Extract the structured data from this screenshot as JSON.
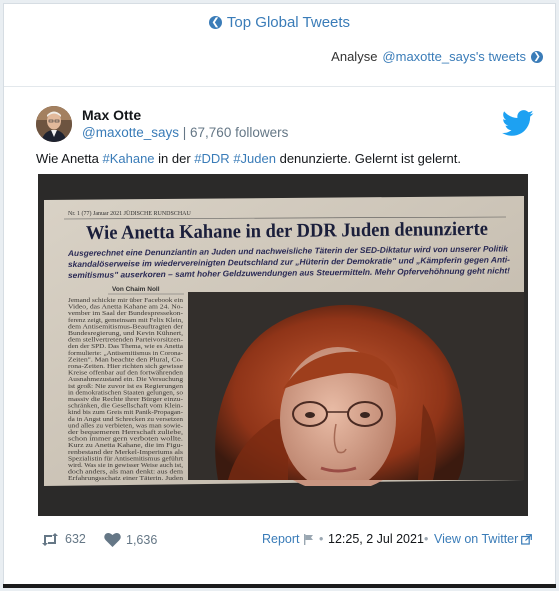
{
  "header": {
    "top_link_label": "Top Global Tweets",
    "analyse_prefix": "Analyse",
    "analyse_user": "@maxotte_says's tweets"
  },
  "tweet": {
    "author_name": "Max Otte",
    "handle": "@maxotte_says",
    "followers": "67,760 followers",
    "text_parts": {
      "p1": "Wie Anetta ",
      "tag1": "#Kahane",
      "p2": " in der ",
      "tag2": "#DDR",
      "p3": " ",
      "tag3": "#Juden",
      "p4": " denunzierte. Gelernt ist gelernt."
    },
    "retweets": "632",
    "likes": "1,636",
    "report_label": "Report",
    "date": "12:25, 2 Jul 2021",
    "view_label": "View on Twitter"
  },
  "image": {
    "masthead": "Nr. 1 (77) Januar 2021    JÜDISCHE RUNDSCHAU",
    "headline": "Wie Anetta Kahane in der DDR Juden denunzierte",
    "lead_lines": [
      "Ausgerechnet eine Denunziantin an Juden und nachweisliche Täterin der SED-Diktatur wird von unserer Politik",
      "skandalöserweise im wiedervereinigten Deutschland zur „Hüterin der Demokratie\" und „Kämpferin gegen Anti-",
      "semitismus\" auserkoren – samt hoher Geldzuwendungen aus Steuermitteln. Mehr Opfervehöhnung geht nicht!"
    ],
    "byline": "Von Chaim Noll",
    "column_lines": [
      "Jemand schickte mir über Facebook ein",
      "Video, das Anetta Kahane am 24. No-",
      "vember im Saal der Bundespressekon-",
      "ferenz zeigt, gemeinsam mit Felix Klein,",
      "dem Antisemitismus-Beauftragten der",
      "Bundesregierung, und Kevin Kühnert,",
      "dem stellvertretenden Parteivorsitzen-",
      "den der SPD. Das Thema, wie es Anetta",
      "formulierte: „Antisemitismus in Corona-",
      "Zeiten\". Man beachte den Plural, Co-",
      "rona-Zeiten. Hier richten sich gewisse",
      "Kreise offenbar auf den fortwährenden",
      "Ausnahmezustand ein. Die Versuchung",
      "ist groß: Nie zuvor ist es Regierungen",
      "in demokratischen Staaten gelungen, so",
      "massiv die Rechte ihrer Bürger einzu-",
      "schränken, die Gesellschaft vom Klein-",
      "kind bis zum Greis mit Panik-Propagan-",
      "da in Angst und Schrecken zu versetzen",
      "und alles zu verbieten, was man sowie-",
      "der bequemeren Herrschaft zuliebe,",
      "schon immer gern verboten wollte.",
      "Kurz zu Anetta Kahane, die im Figu-",
      "renbestand der Merkel-Imperiums als",
      "Spezialistin für Antisemitismus geführt",
      "wird. Was sie in gewisser Weise auch ist,",
      "doch anders, als man denkt: aus dem",
      "Erfahrungsschatz einer Täterin. Juden"
    ]
  },
  "colors": {
    "link": "#3a7cb8",
    "muted": "#657786",
    "twitter_blue": "#1da1f2",
    "headline": "#1b1f3b"
  }
}
